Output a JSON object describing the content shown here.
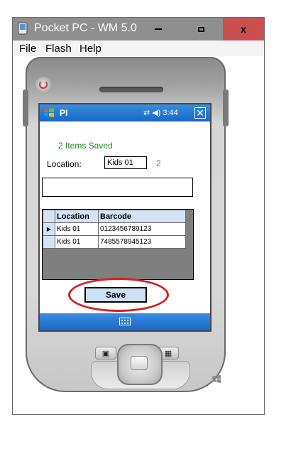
{
  "window": {
    "title": "Pocket PC - WM 5.0",
    "close_glyph": "x",
    "menu": [
      "File",
      "Flash",
      "Help"
    ]
  },
  "device": {
    "screen": {
      "app_title": "PI",
      "tray": {
        "connectivity_icon": "connectivity-icon",
        "volume_icon": "volume-icon",
        "time": "3:44"
      },
      "items_saved": "2 Items Saved",
      "location_label": "Location:",
      "location_value": "Kids 01",
      "count": "2",
      "scan_input_value": "",
      "grid": {
        "headers": [
          "Location",
          "Barcode"
        ],
        "rows": [
          {
            "location": "Kids 01",
            "barcode": "0123456789123"
          },
          {
            "location": "Kids 01",
            "barcode": "7485578945123"
          }
        ]
      },
      "save_label": "Save",
      "keyboard_icon": "keyboard-icon"
    }
  },
  "colors": {
    "titlebar": "#8f8f8f",
    "close_button": "#c94f4f",
    "ppc_blue": "#1768c4",
    "status_green": "#1e8a1e",
    "count_magenta": "#d02fd0",
    "annotation_red": "#d81e1e"
  }
}
